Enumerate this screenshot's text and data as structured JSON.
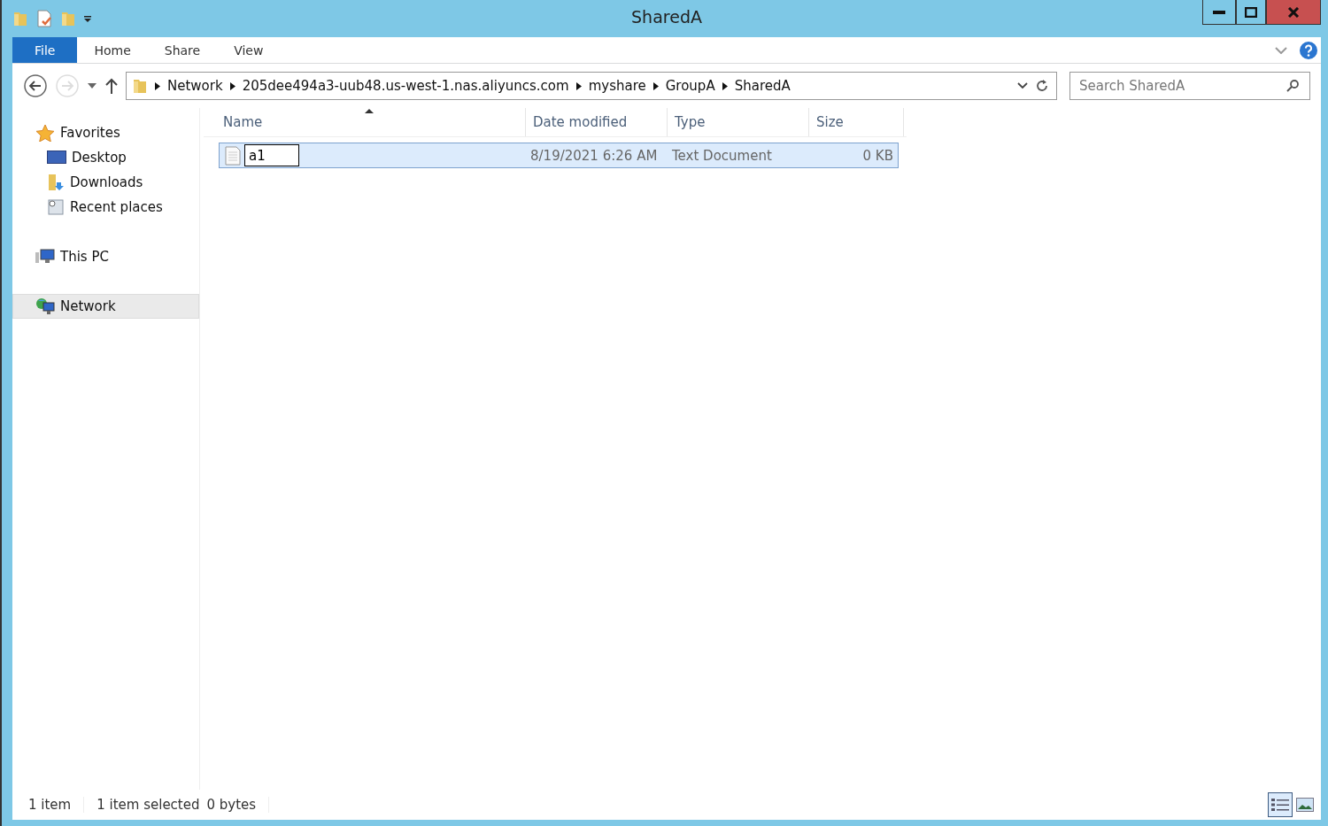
{
  "window": {
    "title": "SharedA"
  },
  "tabs": [
    {
      "label": "File",
      "selected": true
    },
    {
      "label": "Home",
      "selected": false
    },
    {
      "label": "Share",
      "selected": false
    },
    {
      "label": "View",
      "selected": false
    }
  ],
  "address": {
    "crumbs": [
      "Network",
      "205dee494a3-uub48.us-west-1.nas.aliyuncs.com",
      "myshare",
      "GroupA",
      "SharedA"
    ]
  },
  "search": {
    "placeholder": "Search SharedA"
  },
  "sidebar": {
    "items": [
      {
        "label": "Favorites",
        "kind": "favorites",
        "selected": false,
        "children": [
          {
            "label": "Desktop",
            "kind": "desktop",
            "selected": false
          },
          {
            "label": "Downloads",
            "kind": "downloads",
            "selected": false
          },
          {
            "label": "Recent places",
            "kind": "recent",
            "selected": false
          }
        ]
      },
      {
        "label": "This PC",
        "kind": "pc",
        "selected": false
      },
      {
        "label": "Network",
        "kind": "network",
        "selected": true
      }
    ]
  },
  "table": {
    "columns": [
      {
        "label": "Name",
        "sorted": true
      },
      {
        "label": "Date modified",
        "sorted": false
      },
      {
        "label": "Type",
        "sorted": false
      },
      {
        "label": "Size",
        "sorted": false
      }
    ],
    "rows": [
      {
        "name": "a1",
        "renaming": true,
        "date": "8/19/2021 6:26 AM",
        "type": "Text Document",
        "size": "0 KB",
        "selected": true
      }
    ]
  },
  "status_bar": {
    "count": "1 item",
    "selection": "1 item selected",
    "size": "0 bytes"
  },
  "views": [
    {
      "kind": "details",
      "selected": true
    },
    {
      "kind": "thumbnails",
      "selected": false
    }
  ]
}
